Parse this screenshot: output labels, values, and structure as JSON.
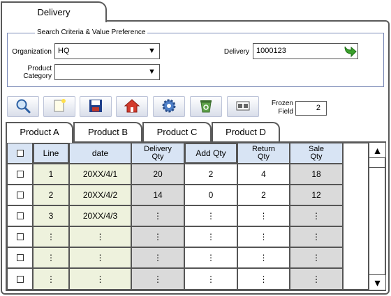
{
  "window": {
    "tab_title": "Delivery"
  },
  "search": {
    "legend": "Search Criteria & Value Preference",
    "organization_label": "Organization",
    "organization_value": "HQ",
    "product_category_label_line1": "Product",
    "product_category_label_line2": "Category",
    "product_category_value": "",
    "delivery_label": "Delivery",
    "delivery_value": "1000123",
    "dropdown_glyph": "▼"
  },
  "toolbar": {
    "buttons": [
      {
        "name": "search",
        "icon": "magnifier-icon"
      },
      {
        "name": "new",
        "icon": "new-document-icon"
      },
      {
        "name": "save",
        "icon": "floppy-disk-icon"
      },
      {
        "name": "home",
        "icon": "home-icon"
      },
      {
        "name": "settings",
        "icon": "gear-icon"
      },
      {
        "name": "delete",
        "icon": "recycle-bin-icon"
      },
      {
        "name": "layout",
        "icon": "window-layout-icon"
      }
    ],
    "frozen_label_line1": "Frozen",
    "frozen_label_line2": "Field",
    "frozen_value": "2"
  },
  "product_tabs": [
    "Product A",
    "Product B",
    "Product C",
    "Product D"
  ],
  "grid": {
    "headers": {
      "line": "Line",
      "date": "date",
      "delivery_qty_1": "Delivery",
      "delivery_qty_2": "Qty",
      "add_qty": "Add Qty",
      "return_qty_1": "Return",
      "return_qty_2": "Qty",
      "sale_qty_1": "Sale",
      "sale_qty_2": "Qty"
    },
    "rows": [
      {
        "line": "1",
        "date": "20XX/4/1",
        "delivery_qty": "20",
        "add_qty": "2",
        "return_qty": "4",
        "sale_qty": "18"
      },
      {
        "line": "2",
        "date": "20XX/4/2",
        "delivery_qty": "14",
        "add_qty": "0",
        "return_qty": "2",
        "sale_qty": "12"
      },
      {
        "line": "3",
        "date": "20XX/4/3",
        "delivery_qty": "⋮",
        "add_qty": "⋮",
        "return_qty": "⋮",
        "sale_qty": "⋮"
      },
      {
        "line": "⋮",
        "date": "⋮",
        "delivery_qty": "⋮",
        "add_qty": "⋮",
        "return_qty": "⋮",
        "sale_qty": "⋮"
      },
      {
        "line": "⋮",
        "date": "⋮",
        "delivery_qty": "⋮",
        "add_qty": "⋮",
        "return_qty": "⋮",
        "sale_qty": "⋮"
      },
      {
        "line": "⋮",
        "date": "⋮",
        "delivery_qty": "⋮",
        "add_qty": "⋮",
        "return_qty": "⋮",
        "sale_qty": "⋮"
      }
    ]
  },
  "scrollbar": {
    "up_glyph": "▲",
    "down_glyph": "▼"
  },
  "colors": {
    "header_bg": "#d8e4f4",
    "frozen_col_bg": "#eef2dd",
    "readonly_col_bg": "#dadada",
    "go_arrow": "#3aa02b"
  }
}
